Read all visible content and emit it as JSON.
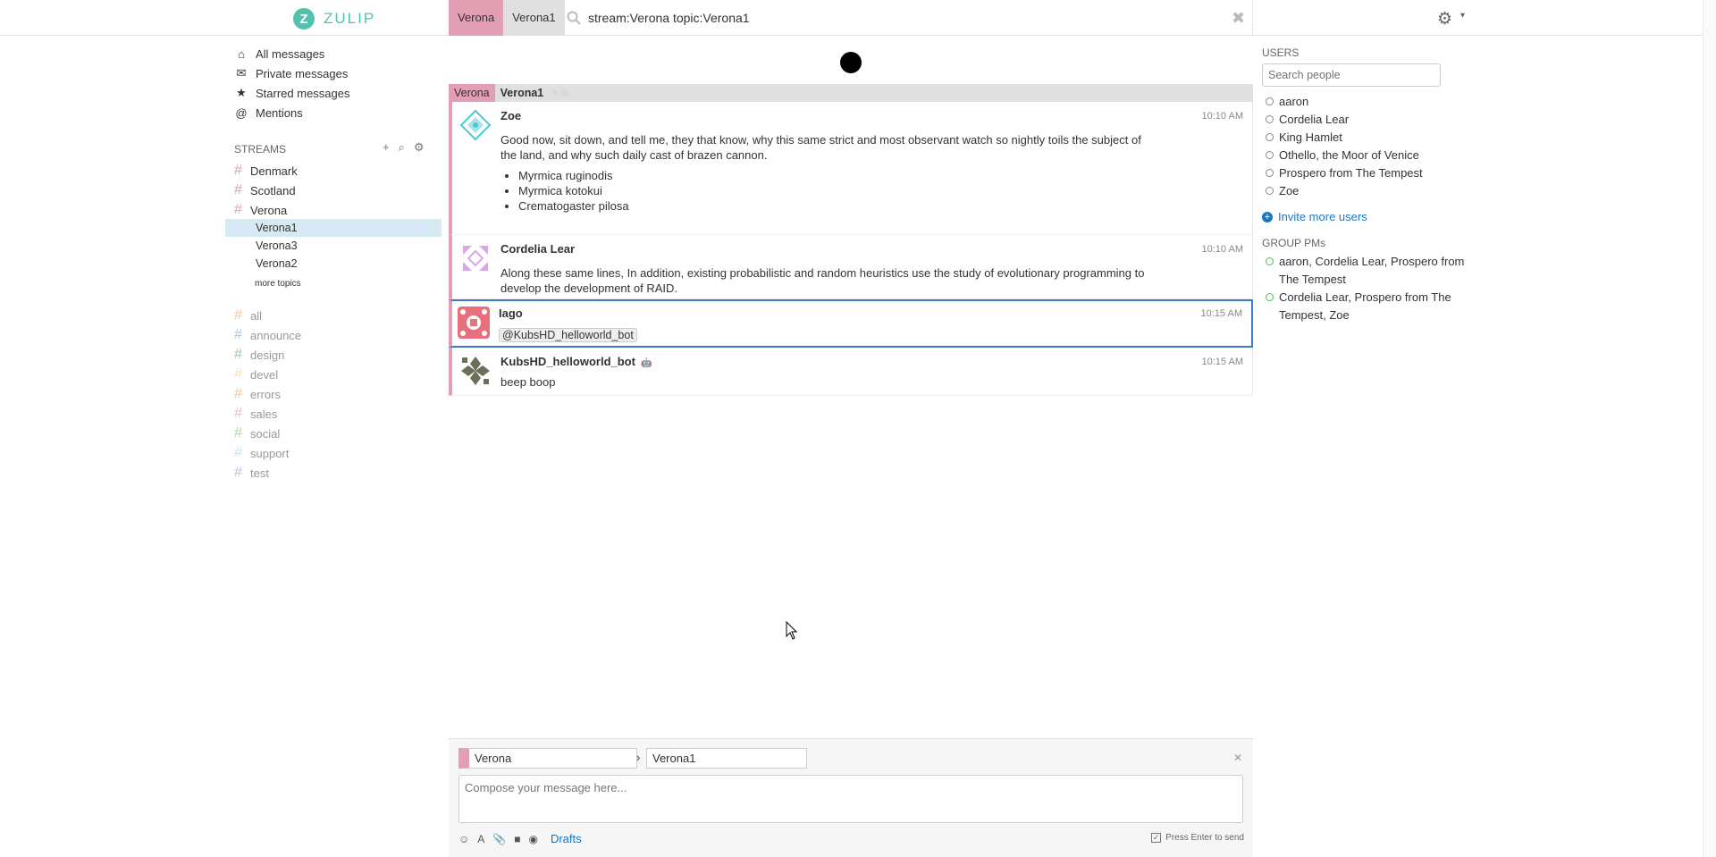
{
  "header": {
    "logo_letter": "Z",
    "logo_text": "ZULIP",
    "tab_stream": "Verona",
    "tab_topic": "Verona1",
    "search_query": "stream:Verona topic:Verona1",
    "search_close": "✖",
    "gear_icon": "⚙",
    "gear_caret": "▾"
  },
  "left_nav": {
    "items": [
      {
        "icon": "⌂",
        "label": "All messages"
      },
      {
        "icon": "✉",
        "label": "Private messages"
      },
      {
        "icon": "★",
        "label": "Starred messages"
      },
      {
        "icon": "@",
        "label": "Mentions"
      }
    ],
    "streams_header": "STREAMS",
    "stream_tool_icons": [
      "+",
      "⌕",
      "⚙"
    ],
    "subscribed": [
      {
        "name": "Denmark",
        "color": "#e29eb3"
      },
      {
        "name": "Scotland",
        "color": "#e29eb3"
      },
      {
        "name": "Verona",
        "color": "#e29eb3"
      }
    ],
    "topics": [
      "Verona1",
      "Verona3",
      "Verona2"
    ],
    "more_topics": "more topics",
    "unsubscribed": [
      {
        "name": "all",
        "color": "#f6c98e"
      },
      {
        "name": "announce",
        "color": "#a6c7e5"
      },
      {
        "name": "design",
        "color": "#95d3a4"
      },
      {
        "name": "devel",
        "color": "#f6e69c"
      },
      {
        "name": "errors",
        "color": "#f6c98e"
      },
      {
        "name": "sales",
        "color": "#f0b9c9"
      },
      {
        "name": "social",
        "color": "#b2d8a4"
      },
      {
        "name": "support",
        "color": "#c2e3f0"
      },
      {
        "name": "test",
        "color": "#c8b8e8"
      }
    ]
  },
  "recipient_bar": {
    "stream": "Verona",
    "topic": "Verona1",
    "icons": "✎ ◎"
  },
  "messages": [
    {
      "sender": "Zoe",
      "time": "10:10 AM",
      "text": "Good now, sit down, and tell me, they that know, why this same strict and most observant watch so nightly toils the subject of the land, and why such daily cast of brazen cannon.",
      "list": [
        "Myrmica ruginodis",
        "Myrmica kotokui",
        "Crematogaster pilosa"
      ],
      "avatar_color": "#4fc7d6"
    },
    {
      "sender": "Cordelia Lear",
      "time": "10:10 AM",
      "text": "Along these same lines, In addition, existing probabilistic and random heuristics use the study of evolutionary programming to develop the development of RAID.",
      "avatar_color": "#d8a8e6"
    },
    {
      "sender": "Iago",
      "time": "10:15 AM",
      "mention": "@KubsHD_helloworld_bot",
      "avatar_color": "#e8707c"
    },
    {
      "sender": "KubsHD_helloworld_bot",
      "bot_icon": "🤖",
      "time": "10:15 AM",
      "text": "beep boop",
      "avatar_color": "#6b6f5a"
    }
  ],
  "right_sidebar": {
    "users_header": "USERS",
    "search_placeholder": "Search people",
    "users": [
      "aaron",
      "Cordelia Lear",
      "King Hamlet",
      "Othello, the Moor of Venice",
      "Prospero from The Tempest",
      "Zoe"
    ],
    "invite_label": "Invite more users",
    "group_pms_header": "GROUP PMs",
    "group_pms": [
      "aaron, Cordelia Lear, Prospero from The Tempest",
      "Cordelia Lear, Prospero from The Tempest, Zoe"
    ]
  },
  "compose": {
    "stream_value": "Verona",
    "arrow": "›",
    "topic_value": "Verona1",
    "close": "✕",
    "placeholder": "Compose your message here...",
    "tool_icons": [
      "☺",
      "A",
      "📎",
      "■",
      "◉"
    ],
    "drafts_label": "Drafts",
    "enter_to_send_label": "Press Enter to send",
    "enter_to_send_checked": true
  },
  "colors": {
    "verona_stream": "#e29eb3",
    "accent_link": "#1a78c2",
    "brand": "#52c2af",
    "selected_message_border": "#3a7bc8"
  }
}
